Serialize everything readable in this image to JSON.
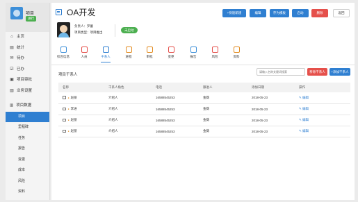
{
  "sidebar": {
    "project_title": "项目",
    "project_tag": "进行",
    "nav": [
      {
        "icon": "home-icon",
        "glyph": "⌂",
        "label": "主页"
      },
      {
        "icon": "stats-icon",
        "glyph": "▤",
        "label": "统计"
      },
      {
        "icon": "todo-icon",
        "glyph": "✉",
        "label": "待办"
      },
      {
        "icon": "done-icon",
        "glyph": "☑",
        "label": "已办"
      },
      {
        "icon": "approval-icon",
        "glyph": "▣",
        "label": "项目审批"
      },
      {
        "icon": "business-settings-icon",
        "glyph": "▥",
        "label": "业务设置"
      }
    ],
    "group_label": "项目数据",
    "sub_items": [
      "项目",
      "里程碑",
      "任务",
      "报告",
      "变更",
      "成本",
      "风险",
      "资料"
    ]
  },
  "header": {
    "title": "OA开发",
    "buttons": [
      {
        "label": "+快速新建",
        "style": "blue"
      },
      {
        "label": "编辑",
        "style": "blue"
      },
      {
        "label": "存为模板",
        "style": "blue"
      },
      {
        "label": "启动",
        "style": "blue"
      },
      {
        "label": "删除",
        "style": "red"
      },
      {
        "label": "返回",
        "style": "white"
      }
    ]
  },
  "info": {
    "owner": "负责人：罗蕾",
    "type": "项目类型：项目推出",
    "status": "未启动"
  },
  "tabs": [
    {
      "label": "综合信息",
      "icon": "overview-icon",
      "color": "#3d8fd9"
    },
    {
      "label": "人员",
      "icon": "person-icon",
      "color": "#e5504b"
    },
    {
      "label": "干系人",
      "icon": "stakeholder-icon",
      "color": "#2f7fd1",
      "active": true
    },
    {
      "label": "进程",
      "icon": "progress-icon",
      "color": "#e28b1f"
    },
    {
      "label": "审批",
      "icon": "approve-icon",
      "color": "#e28b1f"
    },
    {
      "label": "变更",
      "icon": "change-icon",
      "color": "#e5504b"
    },
    {
      "label": "报告",
      "icon": "report-icon",
      "color": "#3d8fd9"
    },
    {
      "label": "风险",
      "icon": "risk-icon",
      "color": "#e5504b"
    },
    {
      "label": "资料",
      "icon": "docs-icon",
      "color": "#e28b1f"
    }
  ],
  "section": {
    "title": "项目干系人",
    "search_placeholder": "请输入名称关键词搜索",
    "delete_label": "移除干系人",
    "add_label": "+添加干系人"
  },
  "table": {
    "headers": [
      "名称",
      "干系人角色",
      "电话",
      "跟进人",
      "添加日期",
      "操作"
    ],
    "rows": [
      {
        "name": "赵丽",
        "role": "介绍人",
        "phone": "16588545253",
        "follower": "金薇",
        "date": "2018-05-23",
        "action": "编辑"
      },
      {
        "name": "李进",
        "role": "介绍人",
        "phone": "16588545253",
        "follower": "金薇",
        "date": "2018-05-23",
        "action": "编辑"
      },
      {
        "name": "赵丽",
        "role": "介绍人",
        "phone": "16588545253",
        "follower": "金薇",
        "date": "2018-05-23",
        "action": "编辑"
      },
      {
        "name": "赵丽",
        "role": "介绍人",
        "phone": "16588545253",
        "follower": "金薇",
        "date": "2018-05-23",
        "action": "编辑"
      }
    ]
  },
  "colors": {
    "accent": "#2f7fd1",
    "danger": "#e5504b",
    "success": "#4caf50",
    "warning": "#e28b1f"
  }
}
